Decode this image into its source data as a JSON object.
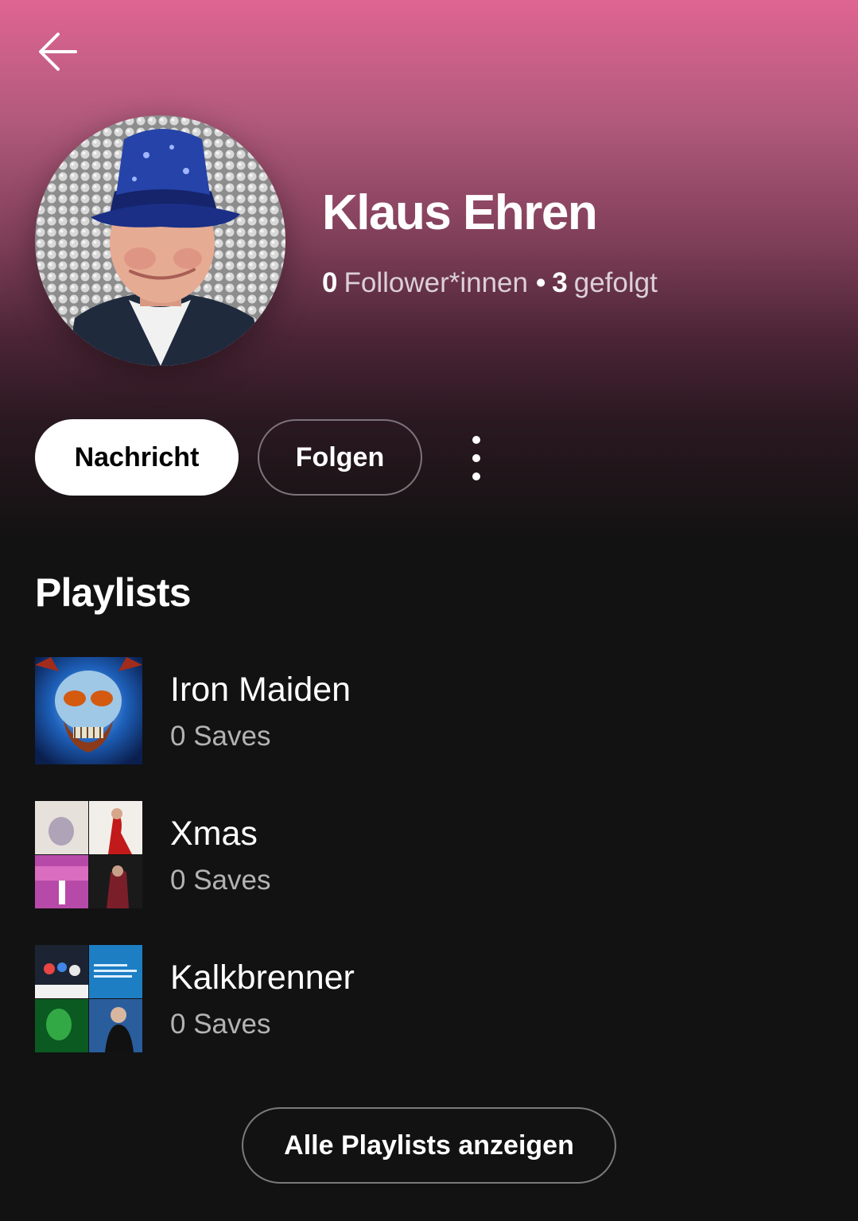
{
  "header": {
    "back_icon": "arrow-left-icon"
  },
  "profile": {
    "name": "Klaus Ehren",
    "followers_count": "0",
    "followers_label": "Follower*innen",
    "separator": "•",
    "following_count": "3",
    "following_label": "gefolgt"
  },
  "actions": {
    "message_label": "Nachricht",
    "follow_label": "Folgen",
    "more_icon": "more-vertical-icon"
  },
  "playlists_section": {
    "title": "Playlists",
    "items": [
      {
        "name": "Iron Maiden",
        "saves": "0 Saves"
      },
      {
        "name": "Xmas",
        "saves": "0 Saves"
      },
      {
        "name": "Kalkbrenner",
        "saves": "0 Saves"
      }
    ],
    "show_all_label": "Alle Playlists anzeigen"
  },
  "colors": {
    "gradient_top": "#df6591",
    "background": "#121212",
    "secondary_text": "#b3b3b3"
  }
}
